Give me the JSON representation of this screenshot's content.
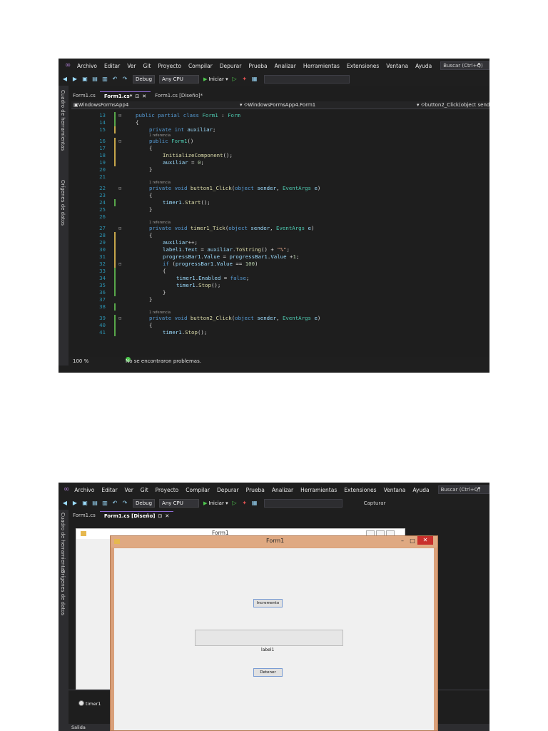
{
  "menu": {
    "items": [
      "Archivo",
      "Editar",
      "Ver",
      "Git",
      "Proyecto",
      "Compilar",
      "Depurar",
      "Prueba",
      "Analizar",
      "Herramientas",
      "Extensiones",
      "Ventana",
      "Ayuda"
    ],
    "search_placeholder": "Buscar (Ctrl+Q)"
  },
  "toolbar": {
    "config": "Debug",
    "platform": "Any CPU",
    "start_label": "Iniciar",
    "capture_label": "Capturar"
  },
  "side_panels": [
    "Cuadro de herramientas",
    "Orígenes de datos"
  ],
  "screen1": {
    "tabs": [
      {
        "label": "Form1.cs",
        "active": false
      },
      {
        "label": "Form1.cs*",
        "active": true
      },
      {
        "label": "Form1.cs [Diseño]*",
        "active": false
      }
    ],
    "nav": {
      "project": "WindowsFormsApp4",
      "class": "WindowsFormsApp4.Form1",
      "member": "button2_Click(object sender"
    },
    "code_lines": [
      {
        "ln": "13",
        "html": "<span class=\"k\">public partial class</span> <span class=\"t\">Form1</span> : <span class=\"t\">Form</span>",
        "indent": 0,
        "fold": "⊟",
        "chg": "saved"
      },
      {
        "ln": "14",
        "html": "{",
        "indent": 0,
        "chg": "saved"
      },
      {
        "ln": "15",
        "html": "<span class=\"k\">private int</span> <span class=\"p\">auxiliar</span>;",
        "indent": 1,
        "chg": "unsaved"
      },
      {
        "ref": "1 referencia",
        "indent": 1
      },
      {
        "ln": "16",
        "html": "<span class=\"k\">public</span> <span class=\"t\">Form1</span>()",
        "indent": 1,
        "fold": "⊟",
        "chg": "unsaved"
      },
      {
        "ln": "17",
        "html": "{",
        "indent": 1,
        "chg": "unsaved"
      },
      {
        "ln": "18",
        "html": "<span class=\"m\">InitializeComponent</span>();",
        "indent": 2,
        "chg": "unsaved"
      },
      {
        "ln": "19",
        "html": "<span class=\"p\">auxiliar</span> = <span class=\"n\">0</span>;",
        "indent": 2,
        "chg": "unsaved"
      },
      {
        "ln": "20",
        "html": "}",
        "indent": 1
      },
      {
        "ln": "21",
        "html": "",
        "indent": 0
      },
      {
        "ref": "1 referencia",
        "indent": 1
      },
      {
        "ln": "22",
        "html": "<span class=\"k\">private void</span> <span class=\"m\">button1_Click</span>(<span class=\"k\">object</span> <span class=\"p\">sender</span>, <span class=\"t\">EventArgs</span> <span class=\"p\">e</span>)",
        "indent": 1,
        "fold": "⊟"
      },
      {
        "ln": "23",
        "html": "{",
        "indent": 1
      },
      {
        "ln": "24",
        "html": "<span class=\"p\">timer1</span>.<span class=\"m\">Start</span>();",
        "indent": 2,
        "chg": "saved"
      },
      {
        "ln": "25",
        "html": "}",
        "indent": 1
      },
      {
        "ln": "26",
        "html": "",
        "indent": 0
      },
      {
        "ref": "1 referencia",
        "indent": 1
      },
      {
        "ln": "27",
        "html": "<span class=\"k\">private void</span> <span class=\"m\">timer1_Tick</span>(<span class=\"k\">object</span> <span class=\"p\">sender</span>, <span class=\"t\">EventArgs</span> <span class=\"p\">e</span>)",
        "indent": 1,
        "fold": "⊟"
      },
      {
        "ln": "28",
        "html": "{",
        "indent": 1,
        "chg": "unsaved"
      },
      {
        "ln": "29",
        "html": "<span class=\"p\">auxiliar</span>++;",
        "indent": 2,
        "chg": "unsaved"
      },
      {
        "ln": "30",
        "html": "<span class=\"p\">label1</span>.<span class=\"p\">Text</span> = <span class=\"p\">auxiliar</span>.<span class=\"m\">ToString</span>() + <span class=\"s\">\"%\"</span>;",
        "indent": 2,
        "chg": "unsaved"
      },
      {
        "ln": "31",
        "html": "<span class=\"p\">progressBar1</span>.<span class=\"p\">Value</span> = <span class=\"p\">progressBar1</span>.<span class=\"p\">Value</span> +<span class=\"n\">1</span>;",
        "indent": 2,
        "chg": "unsaved"
      },
      {
        "ln": "32",
        "html": "<span class=\"k\">if</span> (<span class=\"p\">progressBar1</span>.<span class=\"p\">Value</span> == <span class=\"n\">100</span>)",
        "indent": 2,
        "fold": "⊟",
        "chg": "unsaved"
      },
      {
        "ln": "33",
        "html": "{",
        "indent": 2,
        "chg": "saved"
      },
      {
        "ln": "34",
        "html": "<span class=\"p\">timer1</span>.<span class=\"p\">Enabled</span> = <span class=\"k\">false</span>;",
        "indent": 3,
        "chg": "saved"
      },
      {
        "ln": "35",
        "html": "<span class=\"p\">timer1</span>.<span class=\"m\">Stop</span>();",
        "indent": 3,
        "chg": "saved"
      },
      {
        "ln": "36",
        "html": "}",
        "indent": 2,
        "chg": "saved"
      },
      {
        "ln": "37",
        "html": "}",
        "indent": 1
      },
      {
        "ln": "38",
        "html": "",
        "indent": 0,
        "chg": "saved"
      },
      {
        "ref": "1 referencia",
        "indent": 1
      },
      {
        "ln": "39",
        "html": "<span class=\"k\">private void</span> <span class=\"m\">button2_Click</span>(<span class=\"k\">object</span> <span class=\"p\">sender</span>, <span class=\"t\">EventArgs</span> <span class=\"p\">e</span>)",
        "indent": 1,
        "fold": "⊟",
        "chg": "saved"
      },
      {
        "ln": "40",
        "html": "{",
        "indent": 1,
        "chg": "saved"
      },
      {
        "ln": "41",
        "html": "<span class=\"p\">timer1</span>.<span class=\"m\">Stop</span>();",
        "indent": 2,
        "chg": "saved"
      }
    ],
    "status": {
      "zoom": "100 %",
      "problems": "No se encontraron problemas."
    }
  },
  "screen2": {
    "tabs": [
      {
        "label": "Form1.cs",
        "active": false
      },
      {
        "label": "Form1.cs [Diseño]",
        "active": true
      }
    ],
    "back_form_title": "Form1",
    "tray_item": "timer1",
    "output_label": "Salida",
    "window": {
      "title": "Form1",
      "minimize": "–",
      "maximize": "□",
      "close": "✕",
      "increment_button": "Incremento",
      "progress_fraction": 0.0,
      "label": "label1",
      "stop_button": "Detener"
    }
  },
  "colors": {
    "vs_background": "#1e1e1e",
    "accent_purple": "#8f6cd6",
    "window_border": "#d9a07a",
    "close_red": "#c9302c",
    "change_saved": "#57a64a",
    "change_unsaved": "#c5a54a"
  },
  "icons": [
    "visual-studio-logo-icon",
    "search-icon",
    "play-icon",
    "pin-icon",
    "close-icon",
    "check-circle-icon",
    "timer-icon",
    "window-form-icon"
  ]
}
